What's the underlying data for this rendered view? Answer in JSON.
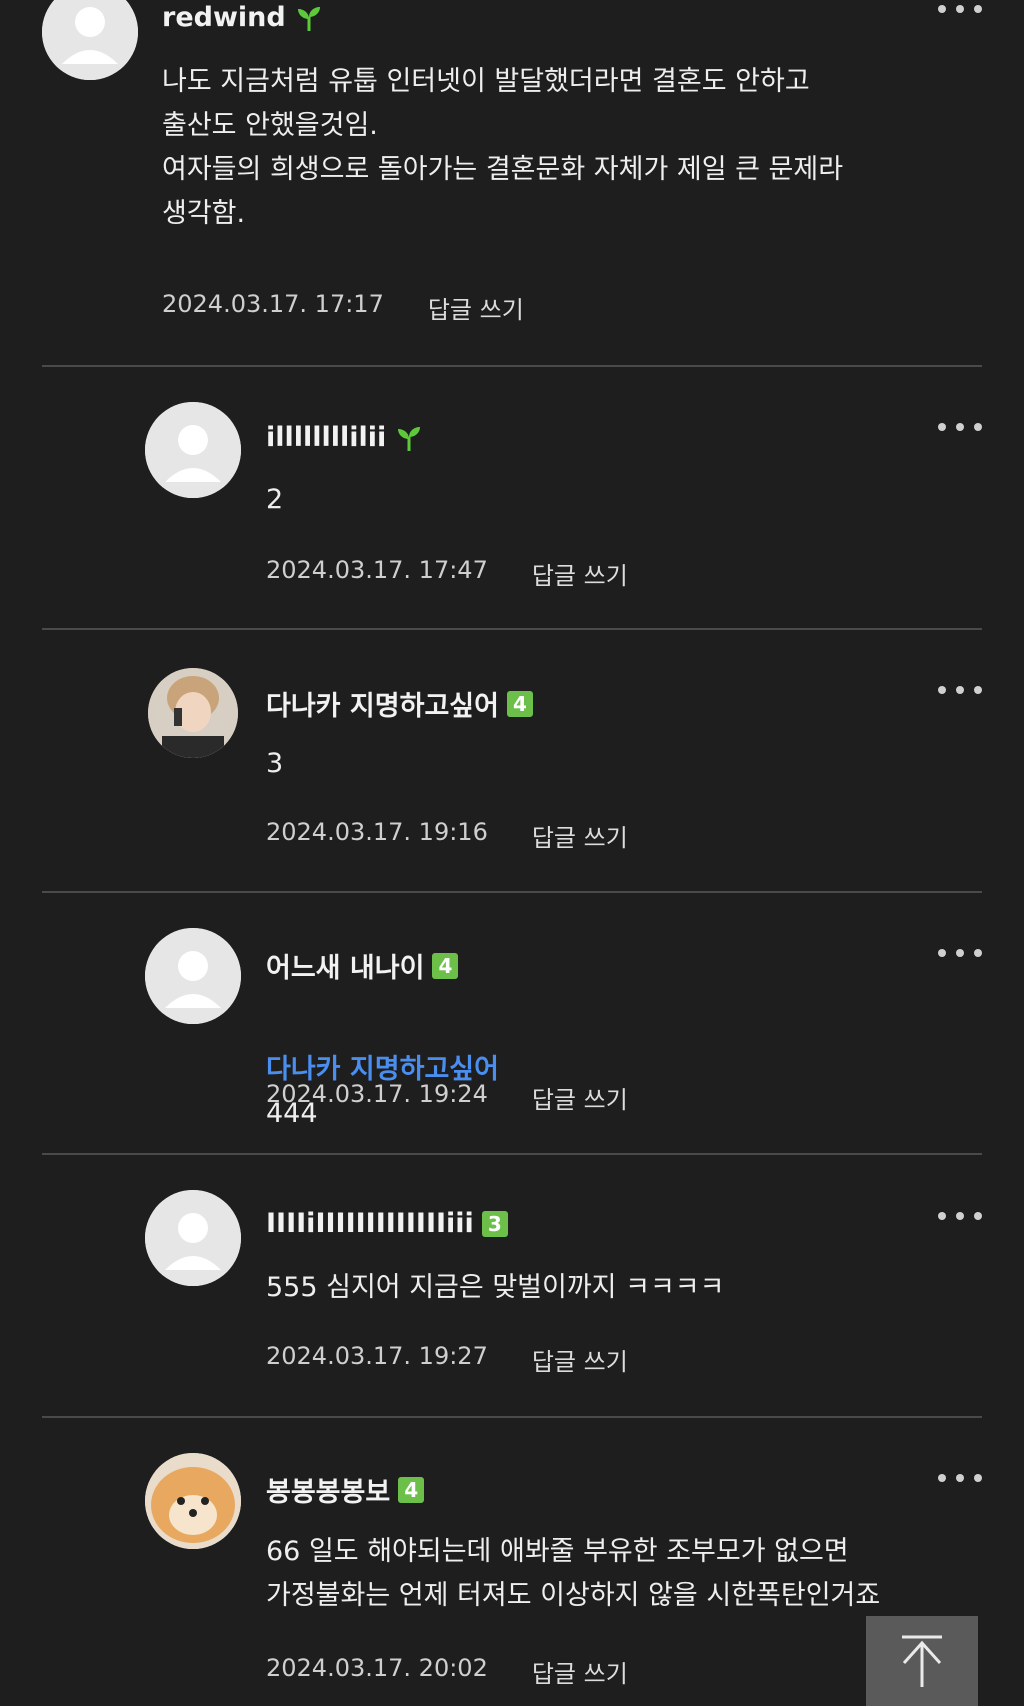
{
  "comments": [
    {
      "username": "redwind",
      "badge": "",
      "body": "나도 지금처럼 유툽 인터넷이 발달했더라면 결혼도 안하고\n출산도 안했을것임.\n여자들의 희생으로 돌아가는 결혼문화 자체가 제일 큰 문제라\n생각함.",
      "mention": "",
      "timestamp": "2024.03.17. 17:17",
      "reply_label": "답글 쓰기"
    },
    {
      "username": "illllllllilii",
      "badge": "",
      "body": "2",
      "mention": "",
      "timestamp": "2024.03.17. 17:47",
      "reply_label": "답글 쓰기"
    },
    {
      "username": "다나카 지명하고싶어",
      "badge": "4",
      "body": "3",
      "mention": "",
      "timestamp": "2024.03.17. 19:16",
      "reply_label": "답글 쓰기"
    },
    {
      "username": "어느새 내나이",
      "badge": "4",
      "body": "444",
      "mention": "다나카 지명하고싶어",
      "timestamp": "2024.03.17. 19:24",
      "reply_label": "답글 쓰기"
    },
    {
      "username": "IIIIiIIIIIIIIIIIIIiii",
      "badge": "3",
      "body": "555 심지어 지금은 맞벌이까지 ㅋㅋㅋㅋ",
      "mention": "",
      "timestamp": "2024.03.17. 19:27",
      "reply_label": "답글 쓰기"
    },
    {
      "username": "봉봉봉봉보",
      "badge": "4",
      "body": "66 일도 해야되는데 애봐줄 부유한 조부모가 없으면\n가정불화는 언제 터져도 이상하지 않을 시한폭탄인거죠",
      "mention": "",
      "timestamp": "2024.03.17. 20:02",
      "reply_label": "답글 쓰기"
    }
  ],
  "icons": {
    "more": "more-icon",
    "sprout": "sprout-icon",
    "scroll_top": "arrow-up-icon"
  },
  "colors": {
    "background": "#1e1e1e",
    "badge": "#6cc04a",
    "mention": "#4a8ef0",
    "sprout": "#5cc93a"
  }
}
